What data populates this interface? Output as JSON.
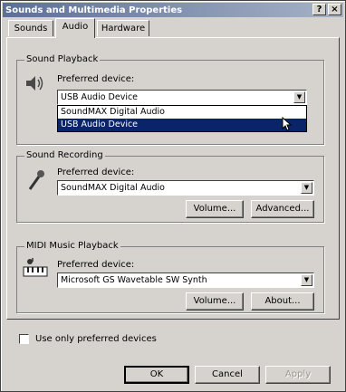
{
  "window": {
    "title": "Sounds and Multimedia Properties",
    "help_glyph": "?",
    "close_glyph": "×"
  },
  "tabs": [
    {
      "label": "Sounds",
      "active": false
    },
    {
      "label": "Audio",
      "active": true
    },
    {
      "label": "Hardware",
      "active": false
    }
  ],
  "playback": {
    "group_label": "Sound Playback",
    "preferred_label": "Preferred device:",
    "selected": "USB Audio Device",
    "dropdown_items": [
      "SoundMAX Digital Audio",
      "USB Audio Device"
    ],
    "highlighted_index": 1
  },
  "recording": {
    "group_label": "Sound Recording",
    "preferred_label": "Preferred device:",
    "selected": "SoundMAX Digital Audio",
    "volume_label": "Volume...",
    "advanced_label": "Advanced..."
  },
  "midi": {
    "group_label": "MIDI Music Playback",
    "preferred_label": "Preferred device:",
    "selected": "Microsoft GS Wavetable SW Synth",
    "volume_label": "Volume...",
    "about_label": "About..."
  },
  "use_only_preferred": {
    "label": "Use only preferred devices",
    "checked": false
  },
  "footer": {
    "ok_label": "OK",
    "cancel_label": "Cancel",
    "apply_label": "Apply"
  }
}
